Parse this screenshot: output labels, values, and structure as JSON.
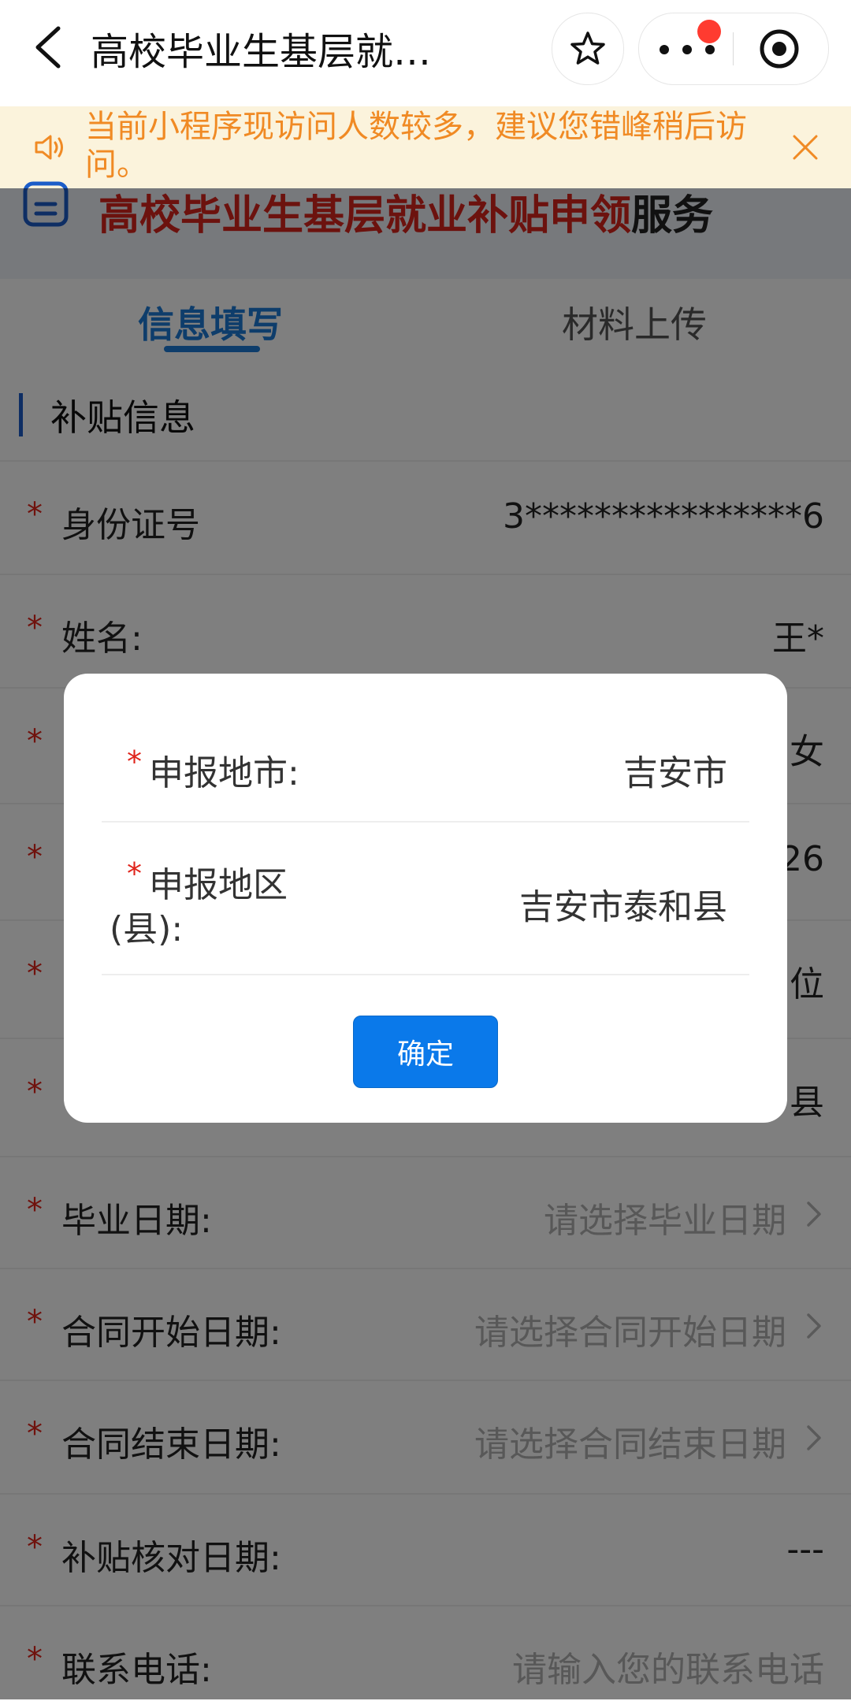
{
  "header": {
    "title": "高校毕业生基层就…",
    "star_icon": "star-icon",
    "menu_icon": "more-dots-icon",
    "target_icon": "record-icon"
  },
  "notice": {
    "text": "当前小程序现访问人数较多，建议您错峰稍后访问。"
  },
  "banner": {
    "title_red": "高校毕业生基层就业补贴申领",
    "title_dark": "服务"
  },
  "tabs": [
    {
      "label": "信息填写",
      "active": true
    },
    {
      "label": "材料上传",
      "active": false
    }
  ],
  "section": {
    "title": "补贴信息"
  },
  "form": {
    "required_mark": "*",
    "rows": [
      {
        "label": "身份证号",
        "value": "3****************6"
      },
      {
        "label": "姓名:",
        "value": "王*"
      },
      {
        "label": "",
        "value": "女"
      },
      {
        "label": "",
        "value": "26"
      },
      {
        "label": "",
        "value": "位"
      },
      {
        "label": "",
        "value": "县"
      },
      {
        "label": "毕业日期:",
        "placeholder": "请选择毕业日期"
      },
      {
        "label": "合同开始日期:",
        "placeholder": "请选择合同开始日期"
      },
      {
        "label": "合同结束日期:",
        "placeholder": "请选择合同结束日期"
      },
      {
        "label": "补贴核对日期:",
        "value": "---"
      },
      {
        "label": "联系电话:",
        "placeholder": "请输入您的联系电话"
      }
    ]
  },
  "modal": {
    "city_label": "申报地市:",
    "city_value": "吉安市",
    "district_label_line1": "申报地区",
    "district_label_line2": "(县):",
    "district_value": "吉安市泰和县",
    "confirm_label": "确定"
  },
  "colors": {
    "accent": "#1c7bd6",
    "required": "#e0241b",
    "notice_text": "#f08a24",
    "confirm": "#0a79ea"
  }
}
